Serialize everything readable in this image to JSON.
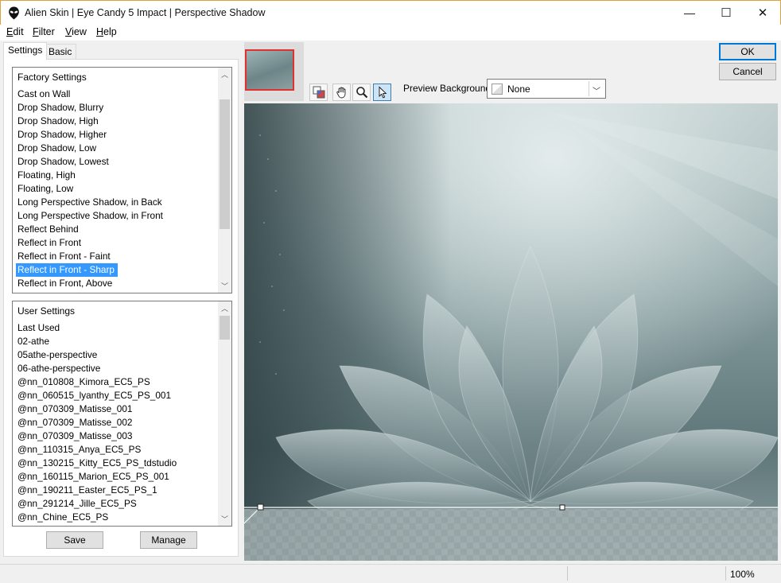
{
  "window": {
    "title": "Alien Skin | Eye Candy 5 Impact | Perspective Shadow",
    "icon": "alien-head-icon",
    "controls": {
      "minimize": "—",
      "maximize": "☐",
      "close": "✕"
    }
  },
  "menu": [
    {
      "label": "Edit",
      "mnemonic": "E",
      "rest": "dit"
    },
    {
      "label": "Filter",
      "mnemonic": "F",
      "rest": "ilter"
    },
    {
      "label": "View",
      "mnemonic": "V",
      "rest": "iew"
    },
    {
      "label": "Help",
      "mnemonic": "H",
      "rest": "elp"
    }
  ],
  "tabs": {
    "settings": "Settings",
    "basic": "Basic"
  },
  "factory": {
    "header": "Factory Settings",
    "items": [
      "Cast on Wall",
      "Drop Shadow, Blurry",
      "Drop Shadow, High",
      "Drop Shadow, Higher",
      "Drop Shadow, Low",
      "Drop Shadow, Lowest",
      "Floating, High",
      "Floating, Low",
      "Long Perspective Shadow, in Back",
      "Long Perspective Shadow, in Front",
      "Reflect Behind",
      "Reflect in Front",
      "Reflect in Front - Faint",
      "Reflect in Front - Sharp",
      "Reflect in Front, Above"
    ],
    "selected": "Reflect in Front - Sharp"
  },
  "user": {
    "header": "User Settings",
    "items": [
      "Last Used",
      "02-athe",
      "05athe-perspective",
      "06-athe-perspective",
      "@nn_010808_Kimora_EC5_PS",
      "@nn_060515_lyanthy_EC5_PS_001",
      "@nn_070309_Matisse_001",
      "@nn_070309_Matisse_002",
      "@nn_070309_Matisse_003",
      "@nn_110315_Anya_EC5_PS",
      "@nn_130215_Kitty_EC5_PS_tdstudio",
      "@nn_160115_Marion_EC5_PS_001",
      "@nn_190211_Easter_EC5_PS_1",
      "@nn_291214_Jille_EC5_PS",
      "@nn_Chine_EC5_PS"
    ]
  },
  "buttons": {
    "save": "Save",
    "manage": "Manage",
    "ok": "OK",
    "cancel": "Cancel"
  },
  "toolbar": {
    "tools": [
      "preview-compare-icon",
      "hand-pan-icon",
      "zoom-magnifier-icon",
      "arrow-select-icon"
    ],
    "active_tool": "arrow-select-icon"
  },
  "preview_background": {
    "label": "Preview Background:",
    "value": "None"
  },
  "status": {
    "zoom": "100%"
  },
  "colors": {
    "selection": "#3399ff",
    "default_button_border": "#0078d7",
    "thumbnail_frame": "#e03030"
  }
}
